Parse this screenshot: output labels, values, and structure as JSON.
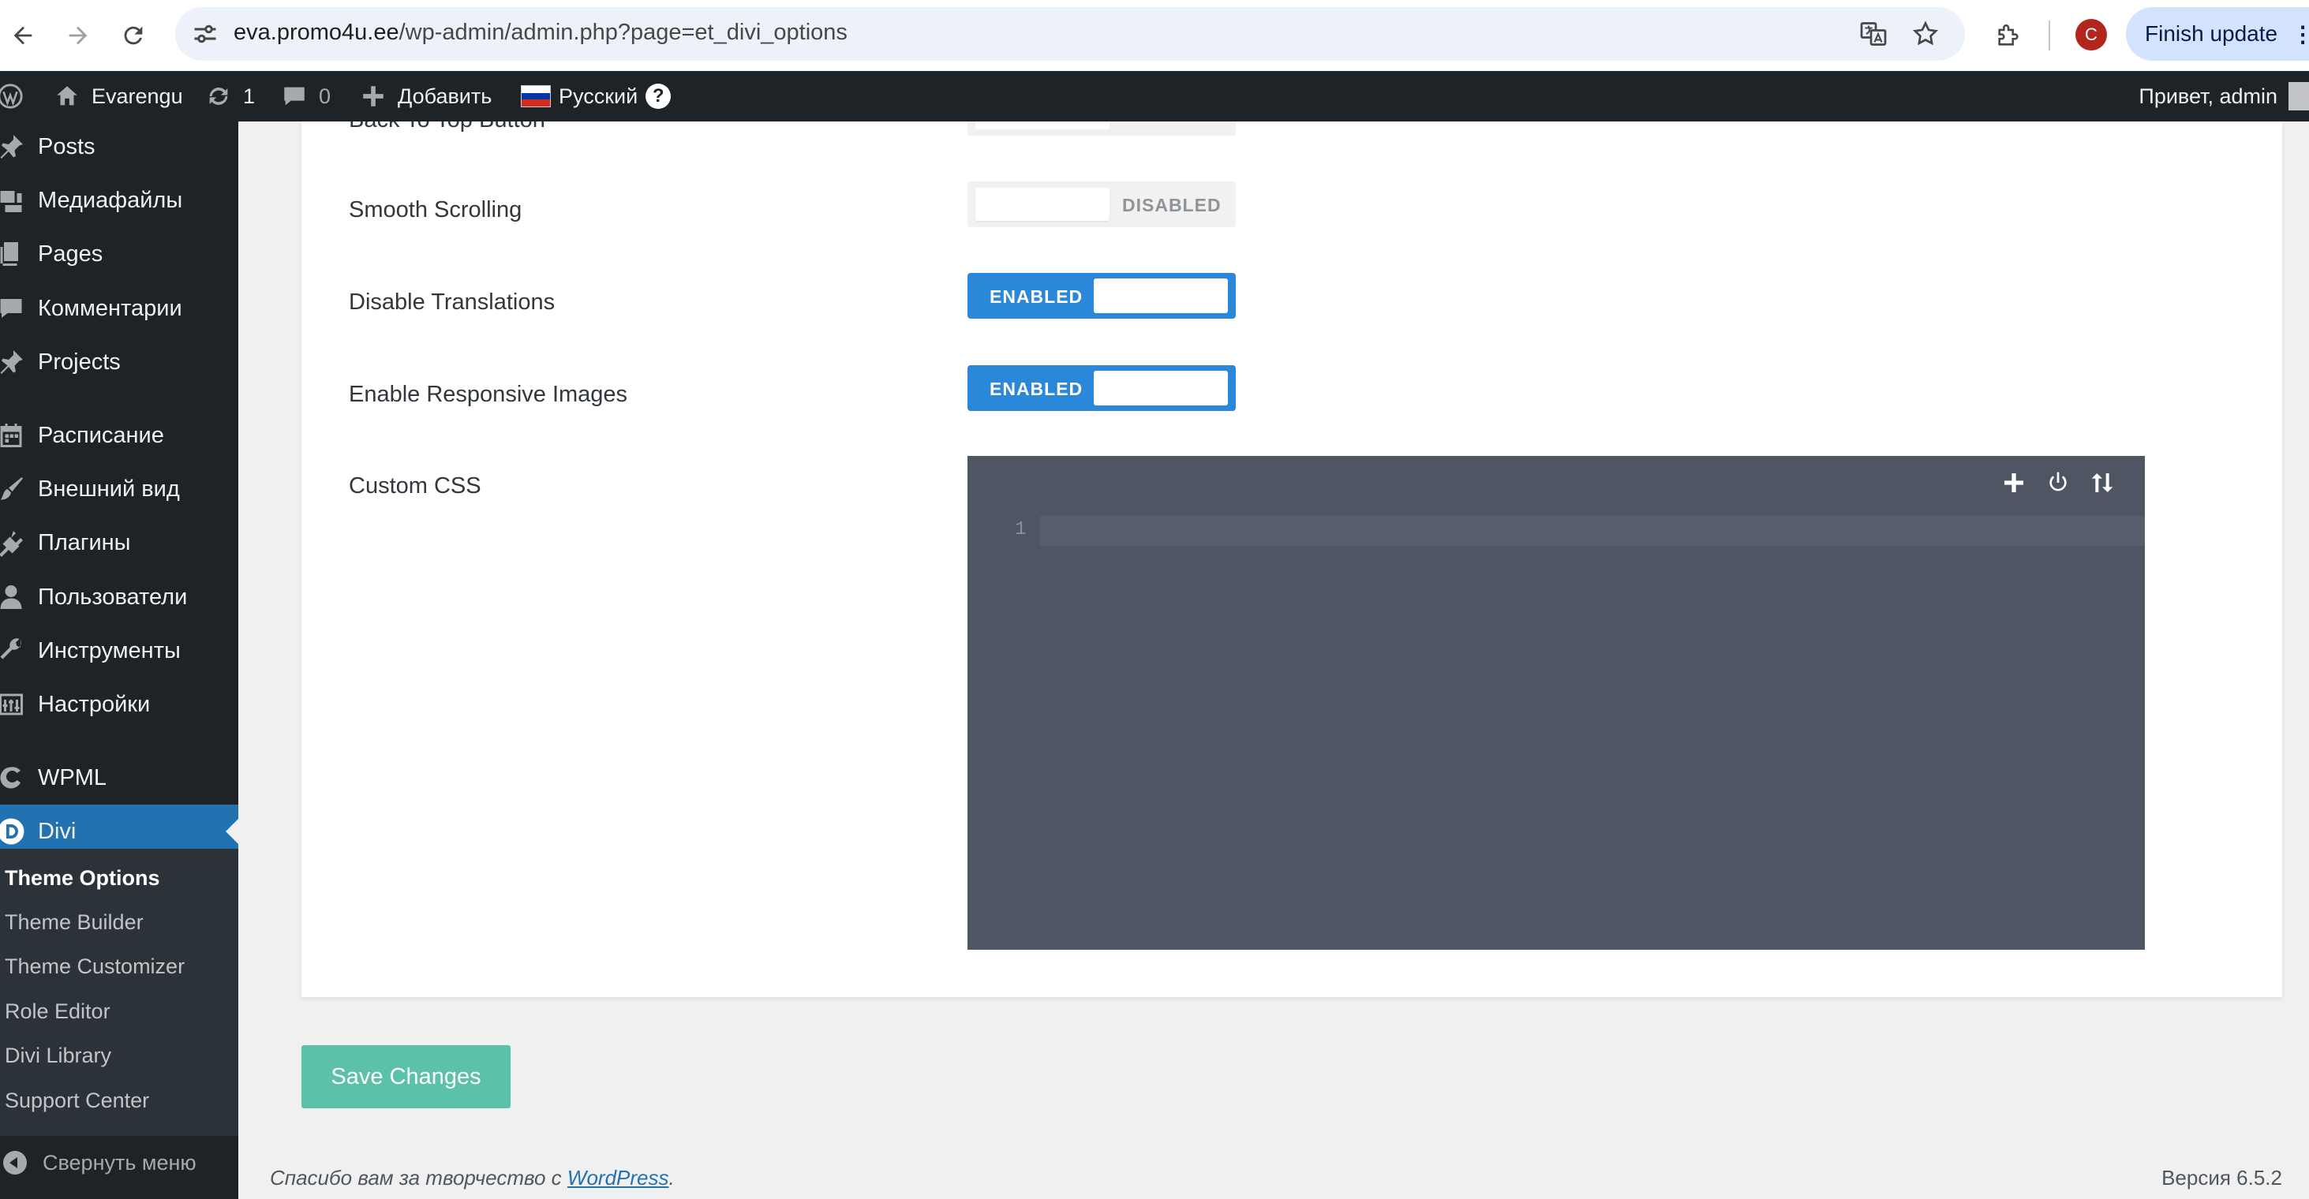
{
  "browser": {
    "url_host": "eva.promo4u.ee",
    "url_path": "/wp-admin/admin.php?page=et_divi_options",
    "profile_initial": "C",
    "finish_update_label": "Finish update"
  },
  "adminbar": {
    "site_name": "Evarengu",
    "updates_count": "1",
    "comments_count": "0",
    "add_new_label": "Добавить",
    "language_label": "Русский",
    "help_label": "?",
    "greeting": "Привет, admin"
  },
  "sidebar": {
    "items": [
      {
        "label": "Posts",
        "icon": "pin-icon"
      },
      {
        "label": "Медиафайлы",
        "icon": "media-icon"
      },
      {
        "label": "Pages",
        "icon": "pages-icon"
      },
      {
        "label": "Комментарии",
        "icon": "comment-icon"
      },
      {
        "label": "Projects",
        "icon": "pin-icon"
      },
      {
        "label": "Расписание",
        "icon": "calendar-icon"
      },
      {
        "label": "Внешний вид",
        "icon": "brush-icon"
      },
      {
        "label": "Плагины",
        "icon": "plugin-icon"
      },
      {
        "label": "Пользователи",
        "icon": "user-icon"
      },
      {
        "label": "Инструменты",
        "icon": "wrench-icon"
      },
      {
        "label": "Настройки",
        "icon": "settings-icon"
      },
      {
        "label": "WPML",
        "icon": "wpml-icon"
      },
      {
        "label": "Divi",
        "icon": "divi-icon"
      }
    ],
    "submenu": [
      "Theme Options",
      "Theme Builder",
      "Theme Customizer",
      "Role Editor",
      "Divi Library",
      "Support Center"
    ],
    "collapse_label": "Свернуть меню"
  },
  "options": {
    "back_to_top_label": "Back To Top Button",
    "smooth_scrolling": {
      "label": "Smooth Scrolling",
      "state": "DISABLED"
    },
    "disable_translations": {
      "label": "Disable Translations",
      "state": "ENABLED"
    },
    "responsive_images": {
      "label": "Enable Responsive Images",
      "state": "ENABLED"
    },
    "custom_css": {
      "label": "Custom CSS",
      "line_number": "1",
      "content": ""
    }
  },
  "save_button_label": "Save Changes",
  "footer": {
    "thanks_prefix": "Спасибо вам за творчество с ",
    "thanks_link": "WordPress",
    "thanks_suffix": ".",
    "version": "Версия 6.5.2"
  },
  "colors": {
    "accent_blue": "#2b87da",
    "sidebar_bg": "#1d2327",
    "divi_active": "#2271b1",
    "save_button": "#5cc1a9",
    "editor_bg": "#4e5563"
  }
}
